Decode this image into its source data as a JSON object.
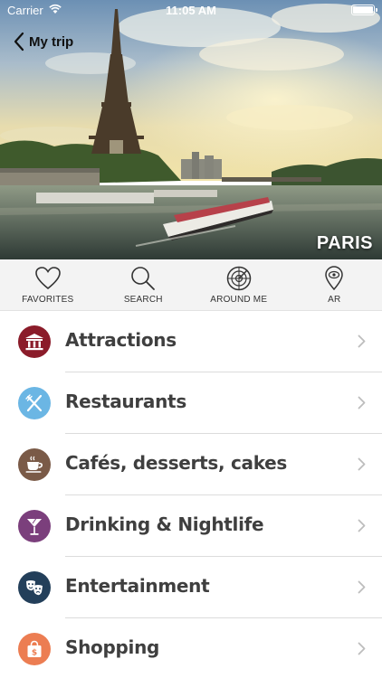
{
  "status_bar": {
    "carrier": "Carrier",
    "time": "11:05 AM"
  },
  "nav": {
    "back_label": "My trip"
  },
  "hero": {
    "city": "PARIS"
  },
  "toolbar": {
    "items": [
      {
        "label": "FAVORITES",
        "icon": "heart-icon"
      },
      {
        "label": "SEARCH",
        "icon": "magnifier-icon"
      },
      {
        "label": "AROUND ME",
        "icon": "radar-icon"
      },
      {
        "label": "AR",
        "icon": "eye-pin-icon"
      }
    ]
  },
  "categories": [
    {
      "label": "Attractions",
      "icon": "museum-icon",
      "color": "#8b1c2a"
    },
    {
      "label": "Restaurants",
      "icon": "fork-knife-icon",
      "color": "#6bb6e4"
    },
    {
      "label": "Cafés, desserts, cakes",
      "icon": "coffee-cup-icon",
      "color": "#7a5a47"
    },
    {
      "label": "Drinking & Nightlife",
      "icon": "cocktail-icon",
      "color": "#7b3f7c"
    },
    {
      "label": "Entertainment",
      "icon": "theater-masks-icon",
      "color": "#233f5a"
    },
    {
      "label": "Shopping",
      "icon": "shopping-bag-icon",
      "color": "#ec7d52"
    }
  ]
}
